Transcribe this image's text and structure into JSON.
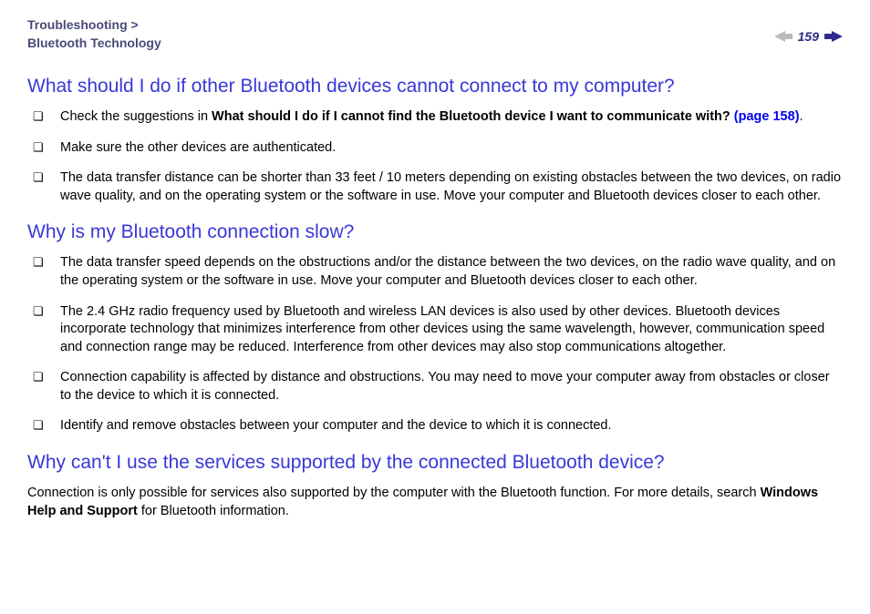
{
  "header": {
    "breadcrumb_line1": "Troubleshooting >",
    "breadcrumb_line2": "Bluetooth Technology",
    "page_number": "159"
  },
  "sections": {
    "q1": {
      "heading": "What should I do if other Bluetooth devices cannot connect to my computer?",
      "item1_pre": "Check the suggestions in ",
      "item1_bold": "What should I do if I cannot find the Bluetooth device I want to communicate with? ",
      "item1_link": "(page 158)",
      "item1_post": ".",
      "item2": "Make sure the other devices are authenticated.",
      "item3": "The data transfer distance can be shorter than 33 feet / 10 meters depending on existing obstacles between the two devices, on radio wave quality, and on the operating system or the software in use. Move your computer and Bluetooth devices closer to each other."
    },
    "q2": {
      "heading": "Why is my Bluetooth connection slow?",
      "item1": "The data transfer speed depends on the obstructions and/or the distance between the two devices, on the radio wave quality, and on the operating system or the software in use. Move your computer and Bluetooth devices closer to each other.",
      "item2": "The 2.4 GHz radio frequency used by Bluetooth and wireless LAN devices is also used by other devices. Bluetooth devices incorporate technology that minimizes interference from other devices using the same wavelength, however, communication speed and connection range may be reduced. Interference from other devices may also stop communications altogether.",
      "item3": "Connection capability is affected by distance and obstructions. You may need to move your computer away from obstacles or closer to the device to which it is connected.",
      "item4": "Identify and remove obstacles between your computer and the device to which it is connected."
    },
    "q3": {
      "heading": "Why can't I use the services supported by the connected Bluetooth device?",
      "para_pre": "Connection is only possible for services also supported by the computer with the Bluetooth function. For more details, search ",
      "para_bold": "Windows Help and Support",
      "para_post": " for Bluetooth information."
    }
  }
}
